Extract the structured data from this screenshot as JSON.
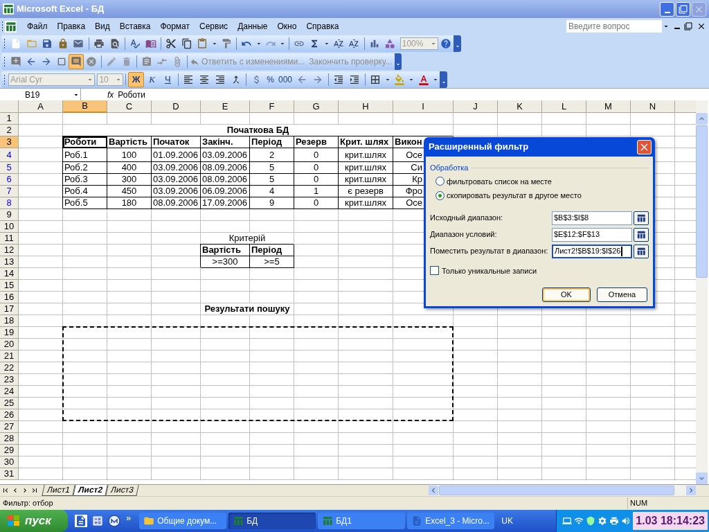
{
  "window": {
    "title": "Microsoft Excel - БД"
  },
  "menu": [
    "Файл",
    "Правка",
    "Вид",
    "Вставка",
    "Формат",
    "Сервис",
    "Данные",
    "Окно",
    "Справка"
  ],
  "help_search": {
    "placeholder": "Введите вопрос"
  },
  "toolbars": {
    "zoom": "100%",
    "comments_shown": true,
    "review": [
      {
        "label": "Ответить с изменениями...",
        "disabled": true
      },
      {
        "label": "Закончить проверку...",
        "disabled": true
      }
    ],
    "font": {
      "name": "Arial Cyr",
      "size": "10"
    },
    "format_buttons": [
      {
        "label": "Ж",
        "selected": true
      },
      {
        "label": "К",
        "selected": false
      },
      {
        "label": "Ч",
        "selected": false
      }
    ],
    "number_buttons": [
      "%",
      "000"
    ]
  },
  "formula_bar": {
    "name_box": "B19",
    "fx": "fx",
    "content": "Роботи"
  },
  "sheet": {
    "copy_marquee": true,
    "columns": [
      {
        "label": "A",
        "selected": false
      },
      {
        "label": "B",
        "selected": true
      },
      {
        "label": "C",
        "selected": false
      },
      {
        "label": "D",
        "selected": false
      },
      {
        "label": "E",
        "selected": false
      },
      {
        "label": "F",
        "selected": false
      },
      {
        "label": "G",
        "selected": false
      },
      {
        "label": "H",
        "selected": false
      },
      {
        "label": "I",
        "selected": false
      },
      {
        "label": "J",
        "selected": false
      },
      {
        "label": "K",
        "selected": false
      },
      {
        "label": "L",
        "selected": false
      },
      {
        "label": "M",
        "selected": false
      },
      {
        "label": "N",
        "selected": false
      }
    ],
    "rows": [
      {
        "label": "1",
        "selected": false,
        "filtered": false
      },
      {
        "label": "2",
        "selected": false,
        "filtered": false,
        "cells": {
          "B-I": {
            "kind": "title",
            "text": "Початкова БД"
          }
        }
      },
      {
        "label": "3",
        "selected": true,
        "filtered": false,
        "cells": {
          "B": {
            "kind": "head",
            "text": "Роботи",
            "active": true
          },
          "C": {
            "kind": "head",
            "text": "Вартість"
          },
          "D": {
            "kind": "head",
            "text": "Початок"
          },
          "E": {
            "kind": "head",
            "text": "Закінч."
          },
          "F": {
            "kind": "head",
            "text": "Період"
          },
          "G": {
            "kind": "head",
            "text": "Резерв"
          },
          "H": {
            "kind": "head",
            "text": "Крит. шлях"
          },
          "I": {
            "kind": "head",
            "text": "Викон"
          }
        }
      },
      {
        "label": "4",
        "selected": false,
        "filtered": true,
        "cells": {
          "B": {
            "kind": "left",
            "text": "Роб.1"
          },
          "C": {
            "kind": "center",
            "text": "100"
          },
          "D": {
            "kind": "left",
            "text": "01.09.2006"
          },
          "E": {
            "kind": "left",
            "text": "03.09.2006"
          },
          "F": {
            "kind": "center",
            "text": "2"
          },
          "G": {
            "kind": "center",
            "text": "0"
          },
          "H": {
            "kind": "center",
            "text": "крит.шлях"
          },
          "I": {
            "kind": "covered",
            "text": "Осе"
          }
        }
      },
      {
        "label": "5",
        "selected": false,
        "filtered": true,
        "cells": {
          "B": {
            "kind": "left",
            "text": "Роб.2"
          },
          "C": {
            "kind": "center",
            "text": "400"
          },
          "D": {
            "kind": "left",
            "text": "03.09.2006"
          },
          "E": {
            "kind": "left",
            "text": "08.09.2006"
          },
          "F": {
            "kind": "center",
            "text": "5"
          },
          "G": {
            "kind": "center",
            "text": "0"
          },
          "H": {
            "kind": "center",
            "text": "крит.шлях"
          },
          "I": {
            "kind": "covered",
            "text": "Си"
          }
        }
      },
      {
        "label": "6",
        "selected": false,
        "filtered": true,
        "cells": {
          "B": {
            "kind": "left",
            "text": "Роб.3"
          },
          "C": {
            "kind": "center",
            "text": "300"
          },
          "D": {
            "kind": "left",
            "text": "03.09.2006"
          },
          "E": {
            "kind": "left",
            "text": "08.09.2006"
          },
          "F": {
            "kind": "center",
            "text": "5"
          },
          "G": {
            "kind": "center",
            "text": "0"
          },
          "H": {
            "kind": "center",
            "text": "крит.шлях"
          },
          "I": {
            "kind": "covered",
            "text": "Кр"
          }
        }
      },
      {
        "label": "7",
        "selected": false,
        "filtered": true,
        "cells": {
          "B": {
            "kind": "left",
            "text": "Роб.4"
          },
          "C": {
            "kind": "center",
            "text": "450"
          },
          "D": {
            "kind": "left",
            "text": "03.09.2006"
          },
          "E": {
            "kind": "left",
            "text": "06.09.2006"
          },
          "F": {
            "kind": "center",
            "text": "4"
          },
          "G": {
            "kind": "center",
            "text": "1"
          },
          "H": {
            "kind": "center",
            "text": "є резерв"
          },
          "I": {
            "kind": "covered",
            "text": "Фро"
          }
        }
      },
      {
        "label": "8",
        "selected": false,
        "filtered": true,
        "cells": {
          "B": {
            "kind": "left",
            "text": "Роб.5"
          },
          "C": {
            "kind": "center",
            "text": "180"
          },
          "D": {
            "kind": "left",
            "text": "08.09.2006"
          },
          "E": {
            "kind": "left",
            "text": "17.09.2006"
          },
          "F": {
            "kind": "center",
            "text": "9"
          },
          "G": {
            "kind": "center",
            "text": "0"
          },
          "H": {
            "kind": "center",
            "text": "крит.шлях"
          },
          "I": {
            "kind": "covered",
            "text": "Осе"
          }
        }
      },
      {
        "label": "9",
        "selected": false,
        "filtered": false
      },
      {
        "label": "10",
        "selected": false,
        "filtered": false
      },
      {
        "label": "11",
        "selected": false,
        "filtered": false,
        "cells": {
          "E-F": {
            "kind": "caption",
            "text": "Критерій"
          }
        }
      },
      {
        "label": "12",
        "selected": false,
        "filtered": false,
        "cells": {
          "E": {
            "kind": "head",
            "text": "Вартість"
          },
          "F": {
            "kind": "head",
            "text": "Період"
          }
        }
      },
      {
        "label": "13",
        "selected": false,
        "filtered": false,
        "cells": {
          "E": {
            "kind": "center",
            "text": ">=300"
          },
          "F": {
            "kind": "center",
            "text": ">=5"
          }
        }
      },
      {
        "label": "14",
        "selected": false,
        "filtered": false
      },
      {
        "label": "15",
        "selected": false,
        "filtered": false
      },
      {
        "label": "16",
        "selected": false,
        "filtered": false
      },
      {
        "label": "17",
        "selected": false,
        "filtered": false,
        "cells": {
          "E-F": {
            "kind": "title",
            "text": "Результати пошуку"
          }
        }
      },
      {
        "label": "18",
        "selected": false,
        "filtered": false
      },
      {
        "label": "19",
        "selected": false,
        "filtered": false
      },
      {
        "label": "20",
        "selected": false,
        "filtered": false
      },
      {
        "label": "21",
        "selected": false,
        "filtered": false
      },
      {
        "label": "22",
        "selected": false,
        "filtered": false
      },
      {
        "label": "23",
        "selected": false,
        "filtered": false
      },
      {
        "label": "24",
        "selected": false,
        "filtered": false
      },
      {
        "label": "25",
        "selected": false,
        "filtered": false
      },
      {
        "label": "26",
        "selected": false,
        "filtered": false
      },
      {
        "label": "27",
        "selected": false,
        "filtered": false
      },
      {
        "label": "28",
        "selected": false,
        "filtered": false
      },
      {
        "label": "29",
        "selected": false,
        "filtered": false
      },
      {
        "label": "30",
        "selected": false,
        "filtered": false
      },
      {
        "label": "31",
        "selected": false,
        "filtered": false
      }
    ]
  },
  "dialog": {
    "title": "Расширенный фильтр",
    "group": "Обработка",
    "options": [
      {
        "label": "фильтровать список на месте",
        "selected": false
      },
      {
        "label": "скопировать результат в другое место",
        "selected": true
      }
    ],
    "fields": [
      {
        "label": "Исходный диапазон:",
        "value": "$B$3:$I$8",
        "focused": false
      },
      {
        "label": "Диапазон условий:",
        "value": "$E$12:$F$13",
        "focused": false
      },
      {
        "label": "Поместить результат в диапазон:",
        "value": "Лист2!$B$19:$I$26",
        "focused": true
      }
    ],
    "checkbox": {
      "label": "Только уникальные записи",
      "checked": false
    },
    "buttons": [
      {
        "label": "OK",
        "default": true
      },
      {
        "label": "Отмена",
        "default": false
      }
    ]
  },
  "sheet_tabs": [
    {
      "label": "Лист1",
      "selected": false
    },
    {
      "label": "Лист2",
      "selected": true
    },
    {
      "label": "Лист3",
      "selected": false
    }
  ],
  "status_bar": {
    "text": "Фильтр: отбор",
    "num": "NUM"
  },
  "taskbar": {
    "start": "пуск",
    "more": "»",
    "language": "UK",
    "clock": "1.03 18:14:23",
    "tasks": [
      {
        "label": "Общие докум...",
        "selected": false,
        "kind": "folder"
      },
      {
        "label": "БД",
        "selected": true,
        "kind": "excel"
      },
      {
        "label": "БД1",
        "selected": false,
        "kind": "excel"
      },
      {
        "label": "Excel_3 - Micro...",
        "selected": false,
        "kind": "word"
      }
    ]
  }
}
